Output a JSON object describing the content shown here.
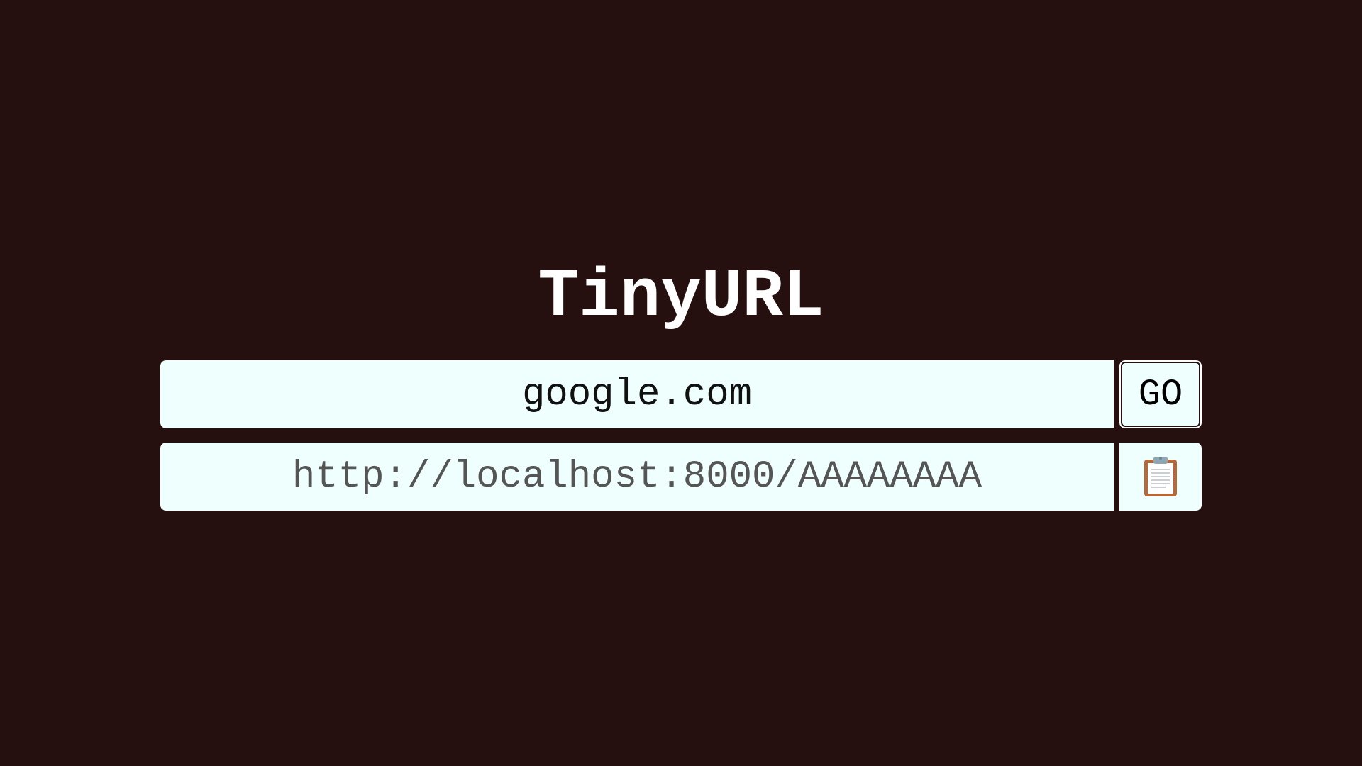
{
  "app": {
    "title": "TinyURL"
  },
  "form": {
    "url_input_value": "google.com",
    "go_label": "GO"
  },
  "result": {
    "short_url": "http://localhost:8000/AAAAAAAA",
    "copy_icon": "clipboard-icon"
  },
  "colors": {
    "background": "#250f0f",
    "field_background": "#effffe",
    "title_text": "#ffffff",
    "result_text": "#555555"
  }
}
